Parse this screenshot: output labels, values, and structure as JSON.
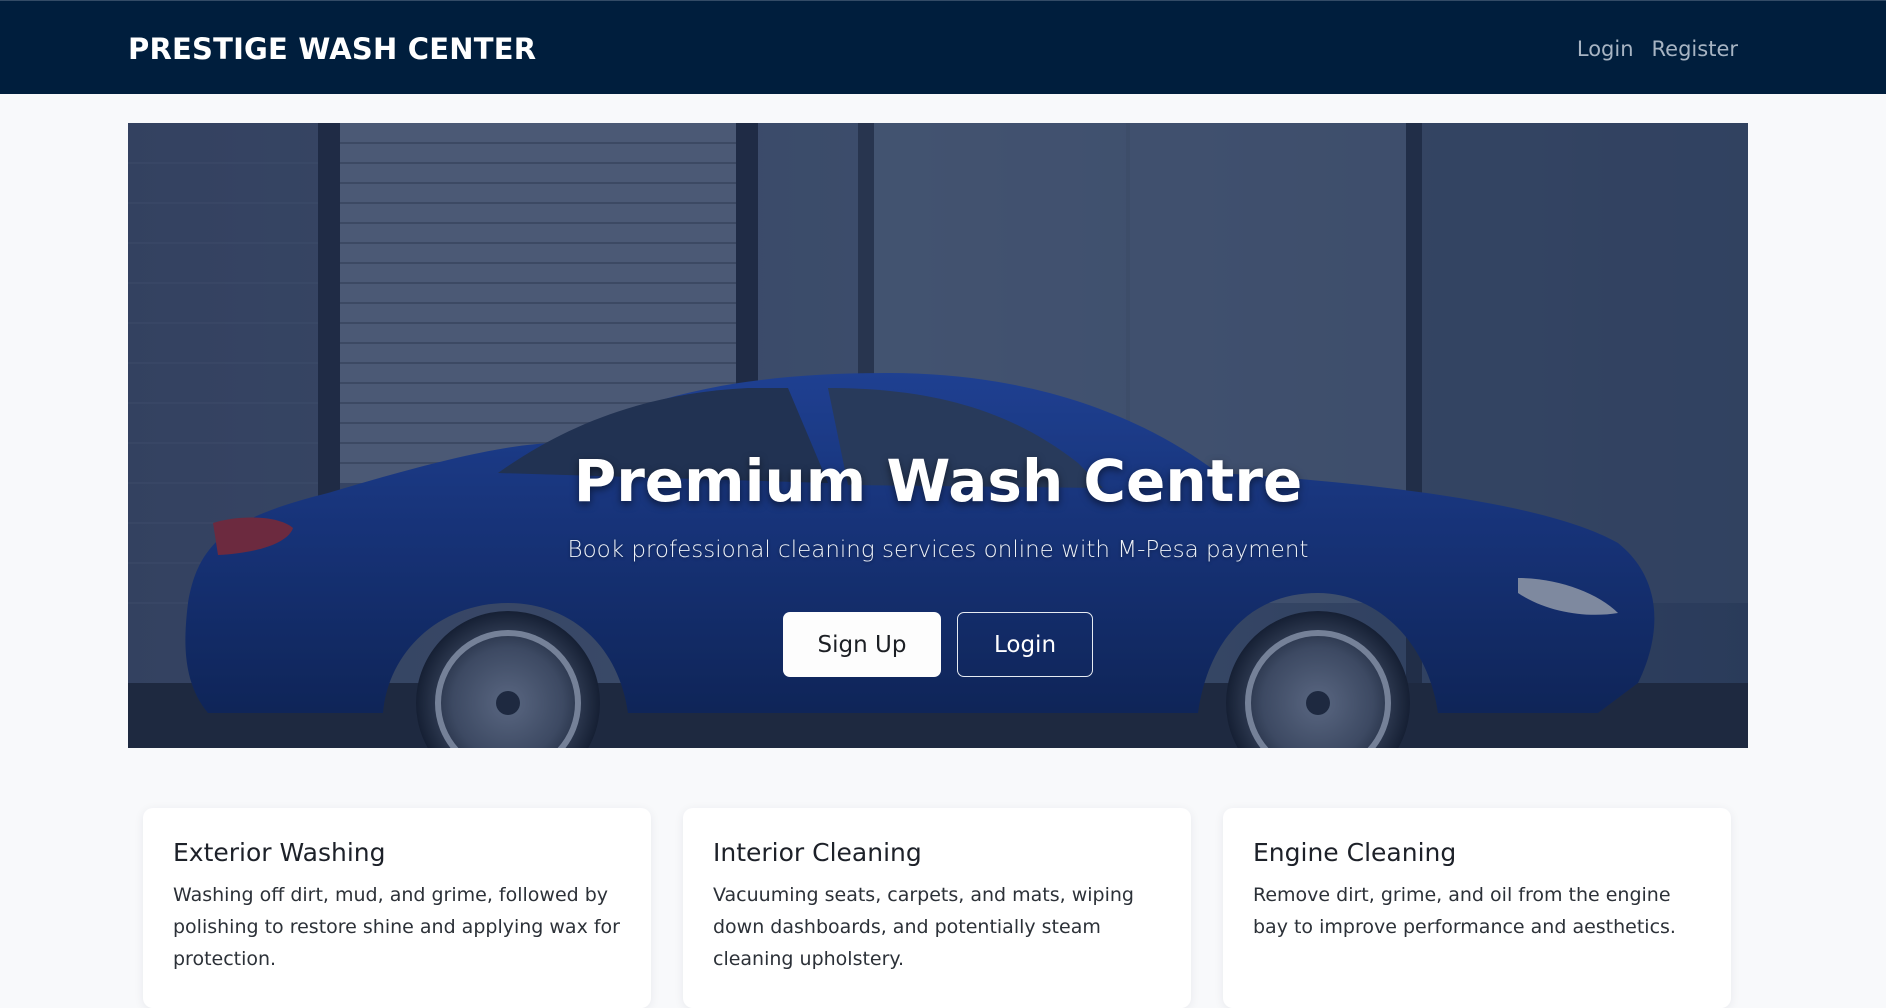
{
  "navbar": {
    "brand": "PRESTIGE WASH CENTER",
    "links": [
      "Login",
      "Register"
    ]
  },
  "hero": {
    "title": "Premium Wash Centre",
    "subtitle": "Book professional cleaning services online with M-Pesa payment",
    "signup_label": "Sign Up",
    "login_label": "Login"
  },
  "services": [
    {
      "title": "Exterior Washing",
      "description": "Washing off dirt, mud, and grime, followed by polishing to restore shine and applying wax for protection."
    },
    {
      "title": "Interior Cleaning",
      "description": "Vacuuming seats, carpets, and mats, wiping down dashboards, and potentially steam cleaning upholstery."
    },
    {
      "title": "Engine Cleaning",
      "description": "Remove dirt, grime, and oil from the engine bay to improve performance and aesthetics."
    }
  ],
  "colors": {
    "navbar_bg": "#001e3d",
    "page_bg": "#f8f9fb",
    "car_blue": "#1e3f96"
  }
}
